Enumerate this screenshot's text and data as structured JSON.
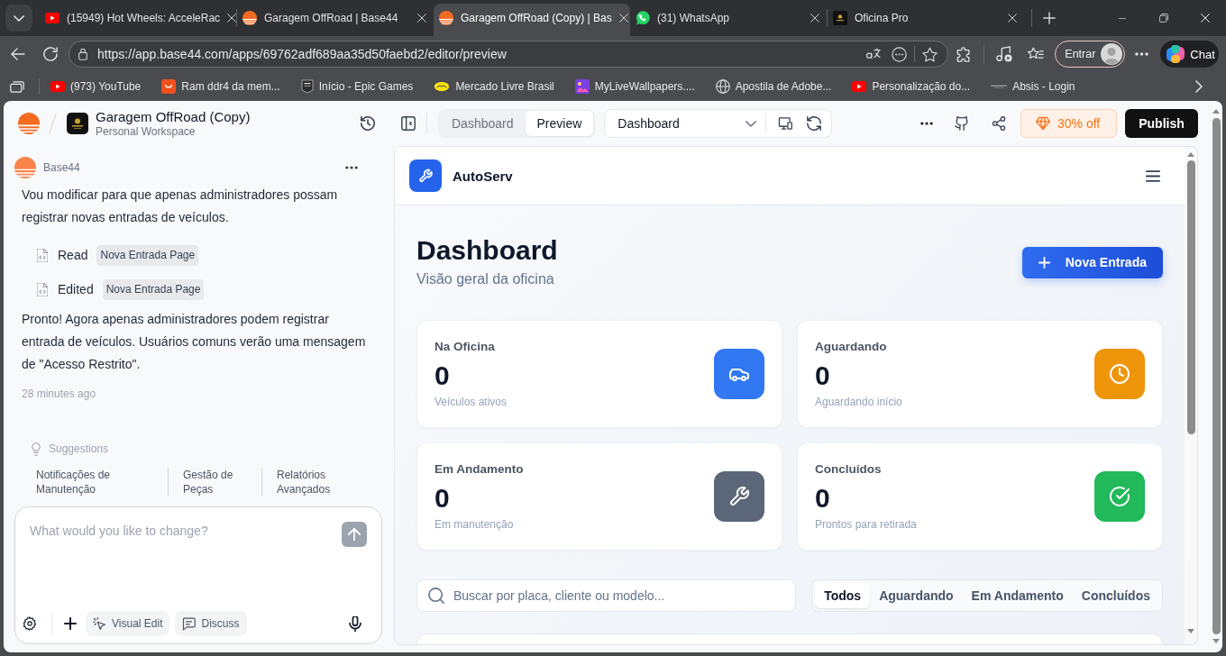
{
  "browser": {
    "tabs": [
      {
        "title": "(15949) Hot Wheels: AcceleRac",
        "selected": false
      },
      {
        "title": "Garagem OffRoad | Base44",
        "selected": false
      },
      {
        "title": "Garagem OffRoad (Copy) | Bas",
        "selected": true
      },
      {
        "title": "(31) WhatsApp",
        "selected": false
      },
      {
        "title": "Oficina Pro",
        "selected": false
      }
    ],
    "url": "https://app.base44.com/apps/69762adf689aa35d50faebd2/editor/preview",
    "profile_button": "Entrar",
    "chat_button": "Chat",
    "bookmarks": [
      "(973) YouTube",
      "Ram ddr4 da mem...",
      "Início - Epic Games",
      "Mercado Livre Brasil",
      "MyLiveWallpapers....",
      "Apostila de Adobe...",
      "Personalização do...",
      "Absis - Login"
    ]
  },
  "editor": {
    "project_title": "Garagem OffRoad (Copy)",
    "workspace": "Personal Workspace",
    "view_tabs": [
      {
        "label": "Dashboard",
        "selected": false
      },
      {
        "label": "Preview",
        "selected": true
      }
    ],
    "page_select": "Dashboard",
    "promo_button": "30% off",
    "publish_button": "Publish"
  },
  "chat": {
    "sender": "Base44",
    "messages": [
      {
        "kind": "text",
        "text": "Vou modificar para que apenas administradores possam registrar novas entradas de veículos."
      },
      {
        "kind": "action",
        "verb": "Read",
        "file": "Nova Entrada Page"
      },
      {
        "kind": "action",
        "verb": "Edited",
        "file": "Nova Entrada Page"
      },
      {
        "kind": "text",
        "text": "Pronto! Agora apenas administradores podem registrar entrada de veículos. Usuários comuns verão uma mensagem de \"Acesso Restrito\"."
      },
      {
        "kind": "time",
        "text": "28 minutes ago"
      }
    ],
    "suggestions": {
      "title": "Suggestions",
      "items": [
        "Notificações de Manutenção",
        "Gestão de Peças",
        "Relatórios Avançados"
      ]
    },
    "composer": {
      "placeholder": "What would you like to change?",
      "send_button": {
        "disabled": true
      },
      "buttons": [
        "Visual Edit",
        "Discuss"
      ]
    }
  },
  "preview": {
    "app_name": "AutoServ",
    "title": "Dashboard",
    "subtitle": "Visão geral da oficina",
    "new_button": "Nova Entrada",
    "stats": [
      {
        "title": "Na Oficina",
        "value": "0",
        "caption": "Veículos ativos",
        "color": "#3178f2"
      },
      {
        "title": "Aguardando",
        "value": "0",
        "caption": "Aguardando início",
        "color": "#ef950a"
      },
      {
        "title": "Em Andamento",
        "value": "0",
        "caption": "Em manutenção",
        "color": "#5b6779"
      },
      {
        "title": "Concluídos",
        "value": "0",
        "caption": "Prontos para retirada",
        "color": "#21b95a"
      }
    ],
    "search_placeholder": "Buscar por placa, cliente ou modelo...",
    "filters": [
      {
        "label": "Todos",
        "selected": true
      },
      {
        "label": "Aguardando",
        "selected": false
      },
      {
        "label": "Em Andamento",
        "selected": false
      },
      {
        "label": "Concluídos",
        "selected": false
      }
    ]
  }
}
